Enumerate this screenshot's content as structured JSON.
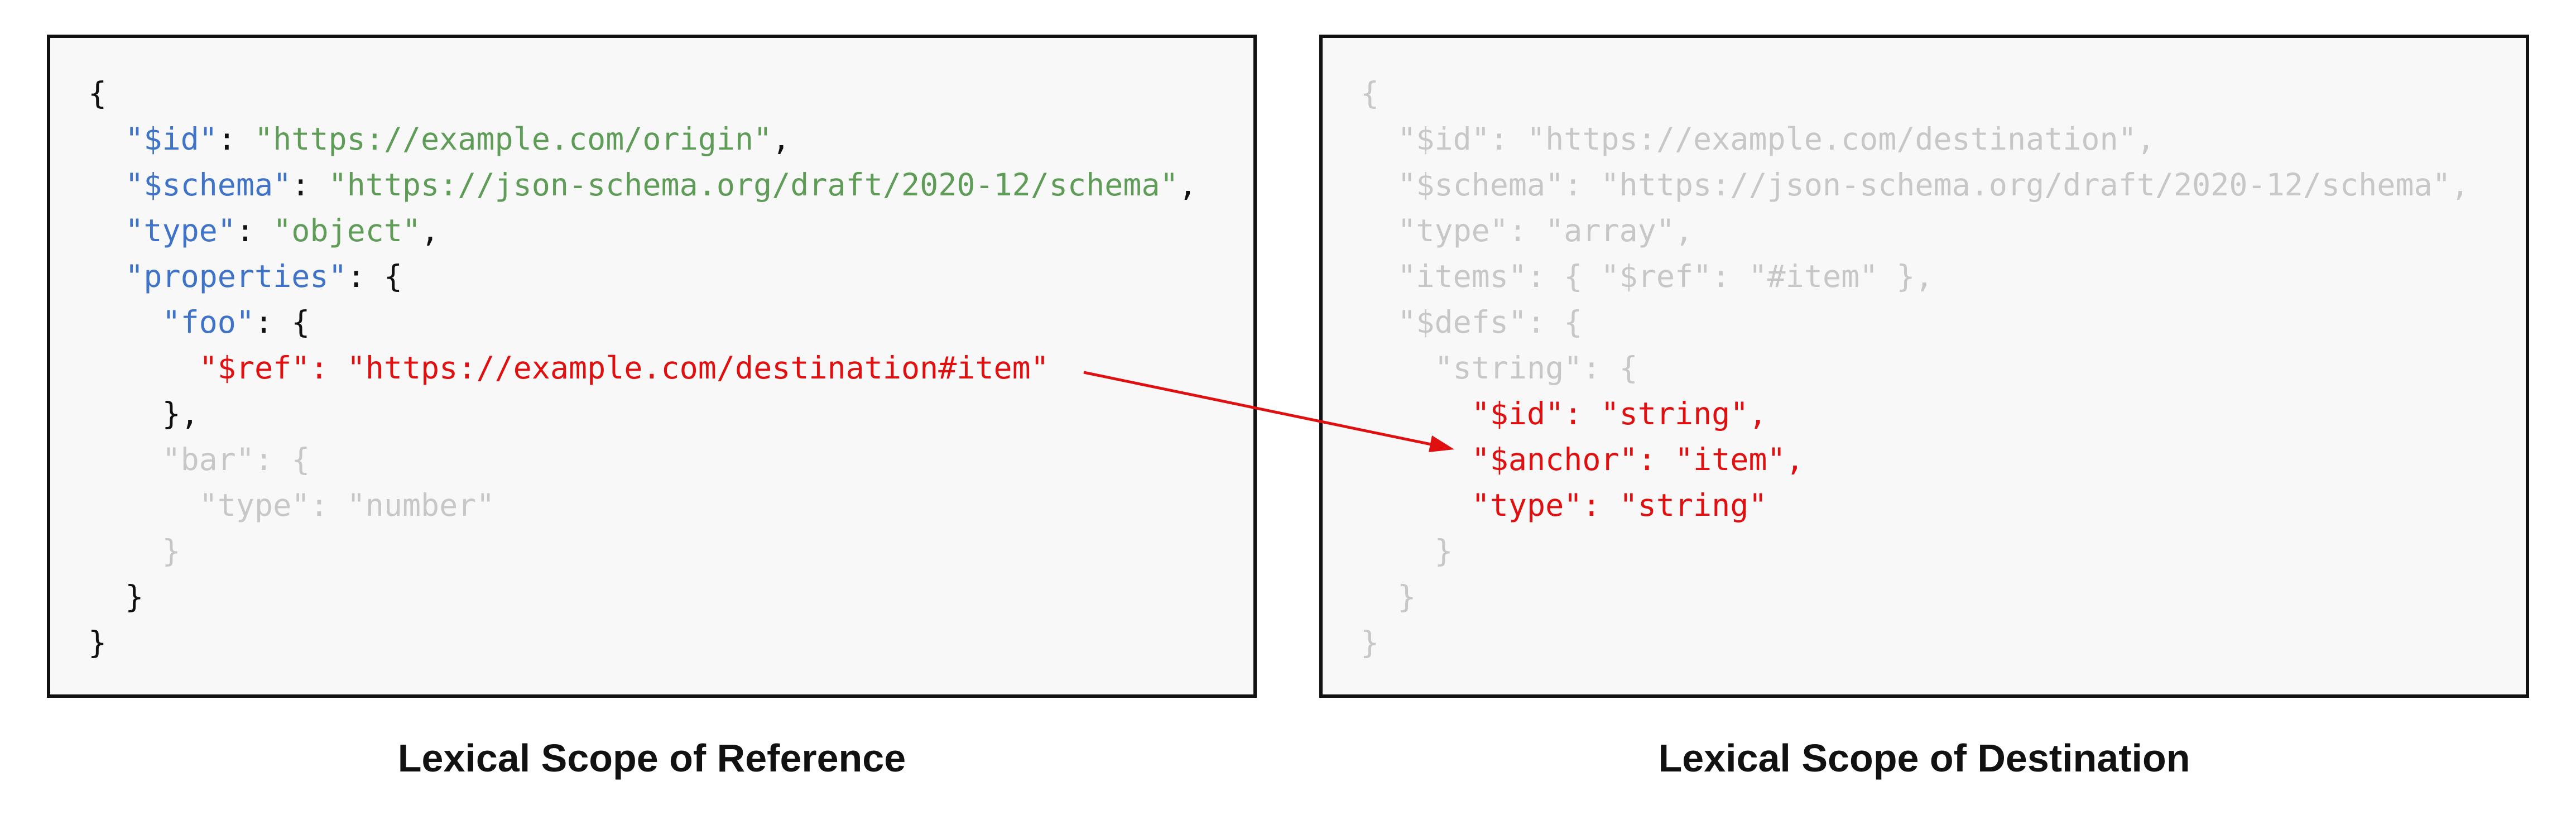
{
  "left": {
    "lines": [
      {
        "i": "",
        "k": "",
        "sep": "",
        "v": "{"
      },
      {
        "i": "  ",
        "k": "\"$id\"",
        "sep": ": ",
        "v": "\"https://example.com/origin\"",
        "t": ","
      },
      {
        "i": "  ",
        "k": "\"$schema\"",
        "sep": ": ",
        "v": "\"https://json-schema.org/draft/2020-12/schema\"",
        "t": ","
      },
      {
        "i": "  ",
        "k": "\"type\"",
        "sep": ": ",
        "v": "\"object\"",
        "t": ","
      },
      {
        "i": "  ",
        "k": "\"properties\"",
        "sep": ": ",
        "v": "{"
      },
      {
        "i": "    ",
        "k": "\"foo\"",
        "sep": ": ",
        "v": "{"
      },
      {
        "i": "      ",
        "k": "\"$ref\"",
        "sep": ": ",
        "v": "\"https://example.com/destination#item\""
      },
      {
        "i": "    ",
        "k": "",
        "sep": "",
        "v": "},"
      },
      {
        "i": "    ",
        "k": "\"bar\"",
        "sep": ": ",
        "v": "{"
      },
      {
        "i": "      ",
        "k": "\"type\"",
        "sep": ": ",
        "v": "\"number\""
      },
      {
        "i": "    ",
        "k": "",
        "sep": "",
        "v": "}"
      },
      {
        "i": "  ",
        "k": "",
        "sep": "",
        "v": "}"
      },
      {
        "i": "",
        "k": "",
        "sep": "",
        "v": "}"
      }
    ],
    "caption": "Lexical Scope of Reference"
  },
  "right": {
    "lines": [
      {
        "i": "",
        "k": "",
        "sep": "",
        "v": "{"
      },
      {
        "i": "  ",
        "k": "\"$id\"",
        "sep": ": ",
        "v": "\"https://example.com/destination\"",
        "t": ","
      },
      {
        "i": "  ",
        "k": "\"$schema\"",
        "sep": ": ",
        "v": "\"https://json-schema.org/draft/2020-12/schema\"",
        "t": ","
      },
      {
        "i": "  ",
        "k": "\"type\"",
        "sep": ": ",
        "v": "\"array\"",
        "t": ","
      },
      {
        "i": "  ",
        "k": "\"items\"",
        "sep": ": ",
        "v": "{ \"$ref\": \"#item\" }",
        "t": ","
      },
      {
        "i": "  ",
        "k": "\"$defs\"",
        "sep": ": ",
        "v": "{"
      },
      {
        "i": "    ",
        "k": "\"string\"",
        "sep": ": ",
        "v": "{"
      },
      {
        "i": "      ",
        "k": "\"$id\"",
        "sep": ": ",
        "v": "\"string\"",
        "t": ","
      },
      {
        "i": "      ",
        "k": "\"$anchor\"",
        "sep": ": ",
        "v": "\"item\"",
        "t": ","
      },
      {
        "i": "      ",
        "k": "\"type\"",
        "sep": ": ",
        "v": "\"string\""
      },
      {
        "i": "    ",
        "k": "",
        "sep": "",
        "v": "}"
      },
      {
        "i": "  ",
        "k": "",
        "sep": "",
        "v": "}"
      },
      {
        "i": "",
        "k": "",
        "sep": "",
        "v": "}"
      }
    ],
    "caption": "Lexical Scope of Destination"
  },
  "colors": {
    "key": "#3f73c8",
    "string": "#5e9c57",
    "highlight": "#e01010",
    "dim": "#c7c7c7",
    "text": "#111111"
  },
  "arrow": {
    "from": "$ref",
    "to": "$anchor"
  }
}
